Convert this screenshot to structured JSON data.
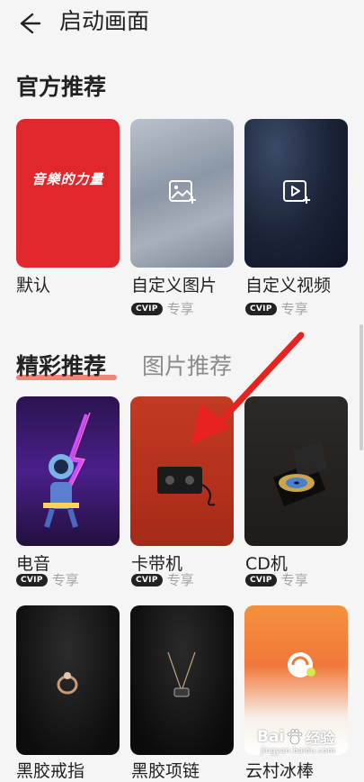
{
  "header": {
    "title": "启动画面"
  },
  "official": {
    "title": "官方推荐",
    "items": [
      {
        "label": "默认",
        "art_text": "音樂的力量",
        "vip": false
      },
      {
        "label": "自定义图片",
        "vip": true
      },
      {
        "label": "自定义视频",
        "vip": true
      }
    ]
  },
  "tabs": [
    {
      "label": "精彩推荐"
    },
    {
      "label": "图片推荐"
    }
  ],
  "featured": {
    "items": [
      {
        "label": "电音",
        "vip": true
      },
      {
        "label": "卡带机",
        "vip": true
      },
      {
        "label": "CD机",
        "vip": true
      },
      {
        "label": "黑胶戒指"
      },
      {
        "label": "黑胶项链"
      },
      {
        "label": "云村冰棒"
      }
    ]
  },
  "badge": {
    "vip": "CVIP",
    "text": "专享"
  },
  "watermark": {
    "brand": "Bai",
    "brand2": "经验",
    "url": "jingyan.baidu.com"
  },
  "colors": {
    "accent": "#e8614f",
    "arrow": "#e8231f",
    "brand_red": "#e0282c"
  }
}
